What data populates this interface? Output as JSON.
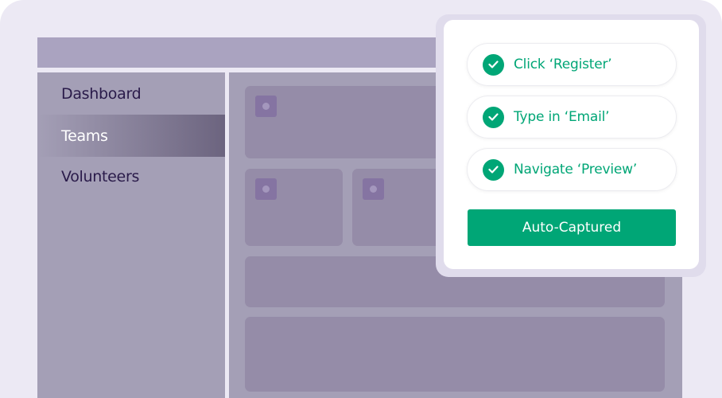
{
  "sidebar": {
    "items": [
      {
        "label": "Dashboard",
        "active": false
      },
      {
        "label": "Teams",
        "active": true
      },
      {
        "label": "Volunteers",
        "active": false
      }
    ]
  },
  "popup": {
    "steps": [
      {
        "label": "Click ‘Register’",
        "icon": "check-circle-icon"
      },
      {
        "label": "Type in ‘Email’",
        "icon": "check-circle-icon"
      },
      {
        "label": "Navigate ‘Preview’",
        "icon": "check-circle-icon"
      }
    ],
    "button_label": "Auto-Captured"
  },
  "colors": {
    "accent": "#00a676",
    "frame": "#a49fb6",
    "background": "#ece9f4"
  }
}
